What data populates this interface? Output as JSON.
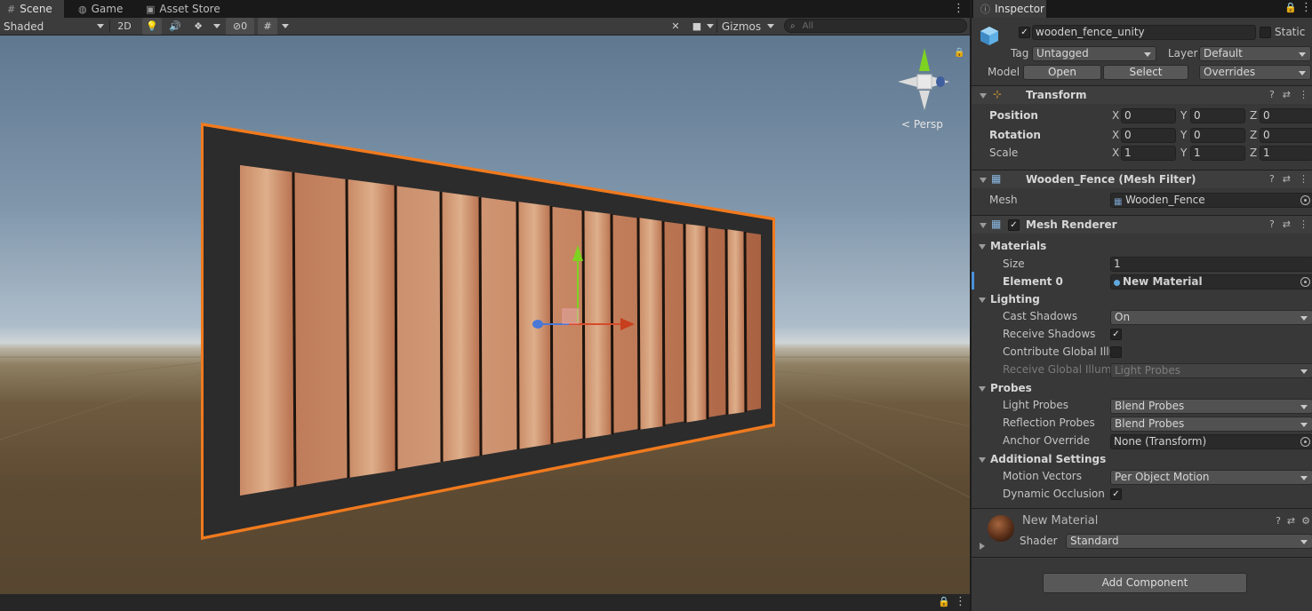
{
  "scene_tabs": [
    {
      "label": "Scene",
      "icon": "hash-icon"
    },
    {
      "label": "Game",
      "icon": "gamepad-icon"
    },
    {
      "label": "Asset Store",
      "icon": "bag-icon"
    }
  ],
  "scene_toolbar": {
    "draw_mode": "Shaded",
    "mode_2d": "2D",
    "hidden_count": "0",
    "gizmos_label": "Gizmos",
    "search_placeholder": "All"
  },
  "viewport": {
    "projection_label": "< Persp"
  },
  "inspector": {
    "tab_label": "Inspector",
    "object_name": "wooden_fence_unity",
    "object_active": true,
    "static_label": "Static",
    "tag_label": "Tag",
    "tag_value": "Untagged",
    "layer_label": "Layer",
    "layer_value": "Default",
    "model_label": "Model",
    "open_label": "Open",
    "select_label": "Select",
    "overrides_label": "Overrides",
    "transform": {
      "title": "Transform",
      "position_label": "Position",
      "rotation_label": "Rotation",
      "scale_label": "Scale",
      "position": {
        "x": "0",
        "y": "0",
        "z": "0"
      },
      "rotation": {
        "x": "0",
        "y": "0",
        "z": "0"
      },
      "scale": {
        "x": "1",
        "y": "1",
        "z": "1"
      },
      "axis_x": "X",
      "axis_y": "Y",
      "axis_z": "Z"
    },
    "mesh_filter": {
      "title": "Wooden_Fence (Mesh Filter)",
      "mesh_label": "Mesh",
      "mesh_value": "Wooden_Fence"
    },
    "mesh_renderer": {
      "title": "Mesh Renderer",
      "enabled": true,
      "materials_label": "Materials",
      "size_label": "Size",
      "size_value": "1",
      "element0_label": "Element 0",
      "element0_value": "New Material",
      "lighting_label": "Lighting",
      "cast_shadows_label": "Cast Shadows",
      "cast_shadows_value": "On",
      "receive_shadows_label": "Receive Shadows",
      "receive_shadows": true,
      "contribute_gi_label": "Contribute Global Illur",
      "contribute_gi": false,
      "receive_gi_label": "Receive Global Illumi",
      "receive_gi_value": "Light Probes",
      "probes_label": "Probes",
      "light_probes_label": "Light Probes",
      "light_probes_value": "Blend Probes",
      "reflection_probes_label": "Reflection Probes",
      "reflection_probes_value": "Blend Probes",
      "anchor_override_label": "Anchor Override",
      "anchor_override_value": "None (Transform)",
      "additional_label": "Additional Settings",
      "motion_vectors_label": "Motion Vectors",
      "motion_vectors_value": "Per Object Motion",
      "dynamic_occlusion_label": "Dynamic Occlusion",
      "dynamic_occlusion": true
    },
    "material": {
      "name": "New Material",
      "shader_label": "Shader",
      "shader_value": "Standard"
    },
    "add_component_label": "Add Component"
  },
  "colors": {
    "selection_outline": "#f07a1e",
    "frame": "#2a2a2a",
    "wood_light": "#c98a66",
    "wood_dark": "#8a4a2e",
    "axis_x": "#d64a2a",
    "axis_y": "#7ed321",
    "axis_z": "#4a78d6"
  }
}
